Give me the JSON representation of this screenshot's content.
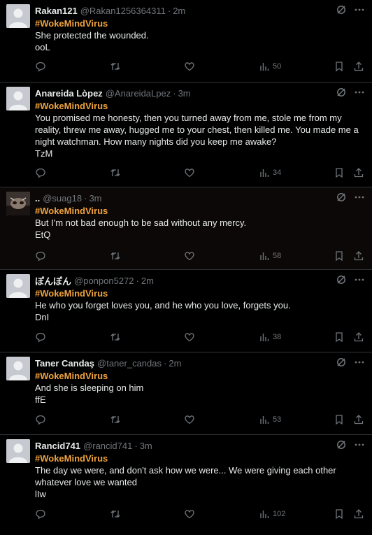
{
  "posts": [
    {
      "name": "Rakan121",
      "handle": "@Rakan1256364311",
      "time": "2m",
      "tag": "#WokeMindVirus",
      "lines": [
        "She protected the wounded.",
        "ooL"
      ],
      "views": "50",
      "avatar": "default"
    },
    {
      "name": "Anareida Lòpez",
      "handle": "@AnareidaLpez",
      "time": "3m",
      "tag": "#WokeMindVirus",
      "lines": [
        "You promised me honesty, then you turned away from me, stole me from my reality, threw me away, hugged me to your chest, then killed me. You made me a night watchman. How many nights did you keep me awake?",
        "TzM"
      ],
      "views": "34",
      "avatar": "default"
    },
    {
      "name": "..",
      "handle": "@suag18",
      "time": "3m",
      "tag": "#WokeMindVirus",
      "lines": [
        "But I'm not bad enough to be sad without any mercy.",
        "EtQ"
      ],
      "views": "58",
      "avatar": "photo"
    },
    {
      "name": "ぽんぽん",
      "handle": "@ponpon5272",
      "time": "2m",
      "tag": "#WokeMindVirus",
      "lines": [
        "He who you forget loves you, and he who you love, forgets you.",
        "DnI"
      ],
      "views": "38",
      "avatar": "default"
    },
    {
      "name": "Taner Candaş",
      "handle": "@taner_candas",
      "time": "2m",
      "tag": "#WokeMindVirus",
      "lines": [
        "And she is sleeping on him",
        "ffE"
      ],
      "views": "53",
      "avatar": "default"
    },
    {
      "name": "Rancid741",
      "handle": "@rancid741",
      "time": "3m",
      "tag": "#WokeMindVirus",
      "lines": [
        "The day we were, and don't ask how we were... We were giving each other whatever love we wanted",
        "lIw"
      ],
      "views": "102",
      "avatar": "default"
    }
  ],
  "icons": {
    "grok": "grok-icon",
    "more": "more-icon",
    "reply": "reply-icon",
    "retweet": "retweet-icon",
    "like": "like-icon",
    "views": "views-icon",
    "bookmark": "bookmark-icon",
    "share": "share-icon"
  },
  "colors": {
    "background": "#000000",
    "text": "#e7e9ea",
    "muted": "#71767b",
    "hashtag": "#f0a33f",
    "divider": "#2f3336"
  }
}
